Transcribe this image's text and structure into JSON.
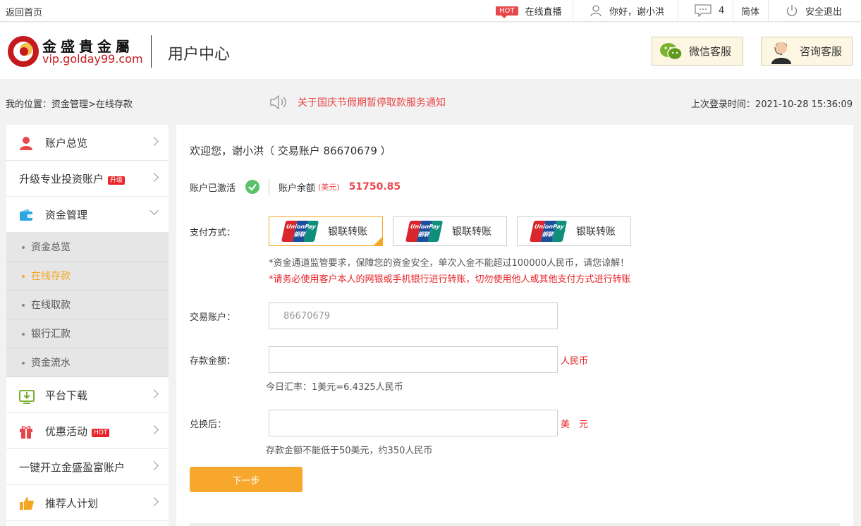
{
  "topbar": {
    "back_home": "返回首页",
    "hot_badge": "HOT",
    "live": "在线直播",
    "greeting": "你好，谢小洪",
    "message_count": "4",
    "language": "简体",
    "logout": "安全退出"
  },
  "header": {
    "logo_cn": "金盛貴金屬",
    "logo_url": "vip.golday99.com",
    "title": "用户中心",
    "wechat_service": "微信客服",
    "consult_service": "咨询客服"
  },
  "breadcrumb": "我的位置：资金管理>在线存款",
  "notice": "关于国庆节假期暂停取款服务通知",
  "last_login": "上次登录时间：2021-10-28 15:36:09",
  "sidebar": {
    "items": [
      {
        "label": "账户总览",
        "icon": "user-icon"
      },
      {
        "label": "升级专业投资账户",
        "badge": "升级"
      },
      {
        "label": "资金管理",
        "icon": "wallet-icon"
      },
      {
        "label": "平台下载",
        "icon": "download-icon"
      },
      {
        "label": "优惠活动",
        "icon": "gift-icon",
        "badge": "HOT"
      },
      {
        "label": "一键开立金盛盈富账户"
      },
      {
        "label": "推荐人计划",
        "icon": "thumbs-up-icon"
      }
    ],
    "sub_items": [
      {
        "label": "资金总览"
      },
      {
        "label": "在线存款",
        "active": true
      },
      {
        "label": "在线取款"
      },
      {
        "label": "银行汇款"
      },
      {
        "label": "资金流水"
      }
    ]
  },
  "main": {
    "welcome": "欢迎您，谢小洪（ 交易账户 86670679 ）",
    "account_status": "账户已激活",
    "balance_label": "账户余额",
    "balance_currency": "(美元)",
    "balance_value": "51750.85",
    "payment_label": "支付方式：",
    "payment_options": [
      {
        "logo": "UnionPay 银联",
        "label": "银联转账"
      },
      {
        "logo": "UnionPay 银联",
        "label": "银联转账"
      },
      {
        "logo": "UnionPay 银联",
        "label": "银联转账"
      }
    ],
    "warning_1": "*资金通道监管要求，保障您的资金安全，单次入金不能超过100000人民币，请您谅解！",
    "warning_2": "*请务必使用客户本人的网银或手机银行进行转账，切勿使用他人或其他支付方式进行转账",
    "account_label": "交易账户：",
    "account_value": "86670679",
    "amount_label": "存款金额：",
    "amount_value": "",
    "amount_unit": "人民币",
    "rate_hint": "今日汇率：1美元=6.4325人民币",
    "converted_label": "兑换后：",
    "converted_value": "",
    "converted_unit": "美　元",
    "min_hint": "存款金额不能低于50美元，约350人民币",
    "next_button": "下一步"
  },
  "colors": {
    "accent_orange": "#f7a82c",
    "alert_red": "#e8242a",
    "brand_red": "#c51a1d"
  }
}
